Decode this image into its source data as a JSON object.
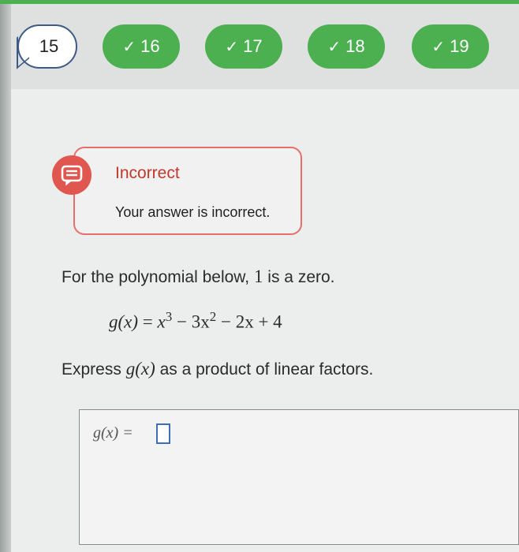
{
  "nav": {
    "current_question": "15",
    "completed_questions": [
      {
        "label": "16"
      },
      {
        "label": "17"
      },
      {
        "label": "18"
      },
      {
        "label": "19"
      }
    ],
    "check_glyph": "✓",
    "accent_color": "#4caf50"
  },
  "feedback": {
    "icon": "chat-bubble-icon",
    "title": "Incorrect",
    "message": "Your answer is incorrect.",
    "status_color": "#e0574f"
  },
  "problem": {
    "prompt_prefix": "For the polynomial below, ",
    "zero_value": "1",
    "prompt_suffix": " is a zero.",
    "function_lhs": "g(x)",
    "equals": "=",
    "term1_base": "x",
    "term1_exp": "3",
    "term2": "− 3x",
    "term2_exp": "2",
    "term3": "− 2x + 4",
    "instruction_prefix": "Express ",
    "instruction_fn": "g(x)",
    "instruction_suffix": " as a product of linear factors."
  },
  "answer": {
    "label": "g(x) =",
    "value": ""
  }
}
